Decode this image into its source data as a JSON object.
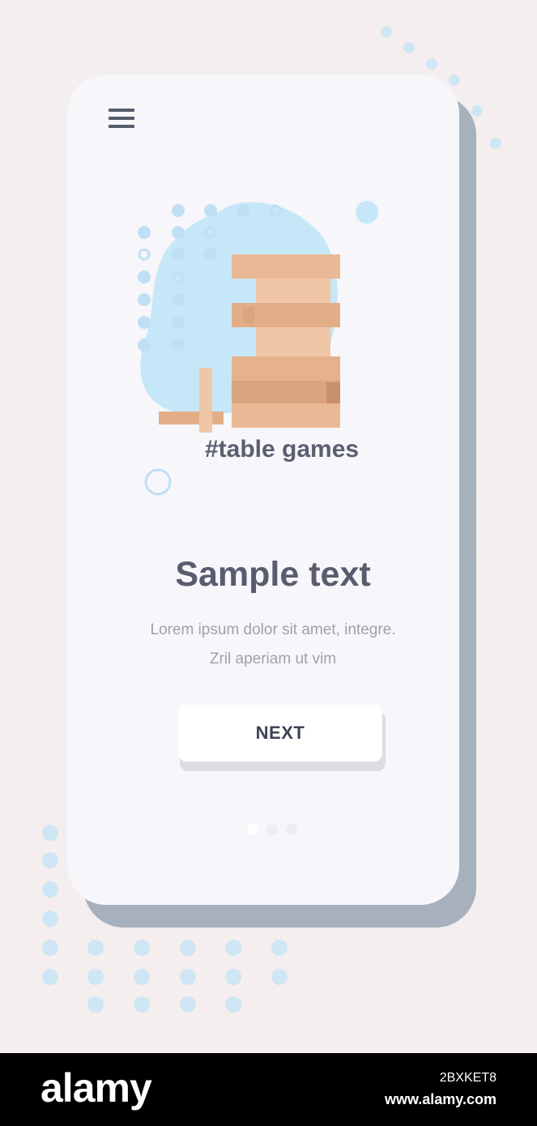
{
  "onboarding": {
    "hashtag": "#table games",
    "title": "Sample text",
    "description_line1": "Lorem ipsum dolor sit amet, integre.",
    "description_line2": "Zril aperiam ut vim",
    "next_label": "NEXT",
    "page_count": 3,
    "active_page": 1
  },
  "illustration": {
    "subject": "wooden block tower game",
    "accent_color": "#c6e7f8",
    "wood_light": "#f0c7a6",
    "wood_dark": "#d9a47f"
  },
  "icons": {
    "menu": "hamburger-menu-icon"
  },
  "footer": {
    "brand": "alamy",
    "image_id": "2BXKET8",
    "site": "www.alamy.com"
  },
  "colors": {
    "text_dark": "#585c6e",
    "text_muted": "#9ea1ac",
    "phone_bg": "#f7f6fa"
  }
}
